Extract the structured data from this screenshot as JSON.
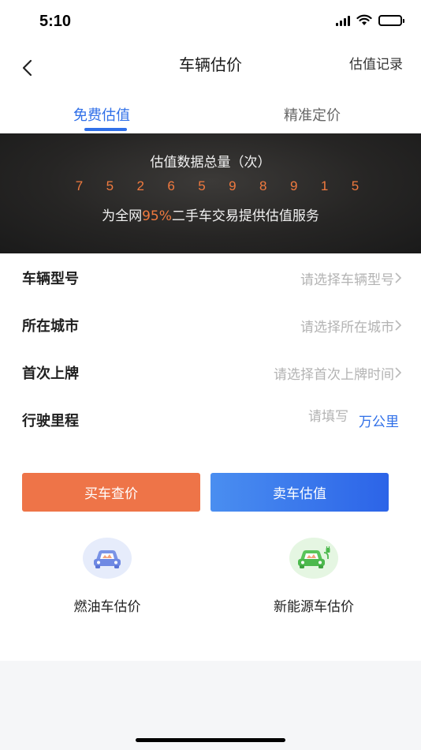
{
  "status_bar": {
    "time": "5:10"
  },
  "nav": {
    "title": "车辆估价",
    "right_link": "估值记录"
  },
  "tabs": [
    {
      "label": "免费估值",
      "active": true
    },
    {
      "label": "精准定价",
      "active": false
    }
  ],
  "banner": {
    "title": "估值数据总量（次）",
    "digits": [
      "7",
      "5",
      "2",
      "6",
      "5",
      "9",
      "8",
      "9",
      "1",
      "5"
    ],
    "subtitle_prefix": "为全网",
    "subtitle_highlight": "95%",
    "subtitle_suffix": "二手车交易提供估值服务"
  },
  "form": {
    "rows": [
      {
        "label": "车辆型号",
        "placeholder": "请选择车辆型号"
      },
      {
        "label": "所在城市",
        "placeholder": "请选择所在城市"
      },
      {
        "label": "首次上牌",
        "placeholder": "请选择首次上牌时间"
      }
    ],
    "mileage": {
      "label": "行驶里程",
      "placeholder": "请填写",
      "unit": "万公里"
    }
  },
  "buttons": {
    "buy": "买车查价",
    "sell": "卖车估值"
  },
  "entries": [
    {
      "label": "燃油车估价",
      "icon": "fuel-car-icon"
    },
    {
      "label": "新能源车估价",
      "icon": "electric-car-icon"
    }
  ],
  "colors": {
    "accent_blue": "#2f6fe8",
    "accent_orange": "#ee7448",
    "digit_orange": "#f07a3f"
  }
}
